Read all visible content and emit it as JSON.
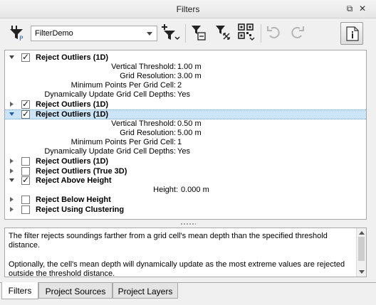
{
  "window": {
    "title": "Filters"
  },
  "toolbar": {
    "filter_set_value": "FilterDemo",
    "buttons": [
      "add-filter-icon",
      "remove-filter-icon",
      "collapse-all-icon",
      "qr-filter-icon",
      "undo-icon",
      "redo-icon",
      "info-icon"
    ]
  },
  "tree": {
    "f1": {
      "label": "Reject Outliers (1D)",
      "checked": true,
      "expanded": true,
      "params": [
        {
          "label": "Vertical Threshold:",
          "value": "1.00 m"
        },
        {
          "label": "Grid Resolution:",
          "value": "3.00 m"
        },
        {
          "label": "Minimum Points Per Grid Cell:",
          "value": "2"
        },
        {
          "label": "Dynamically Update Grid Cell Depths:",
          "value": "Yes"
        }
      ]
    },
    "f2": {
      "label": "Reject Outliers (1D)",
      "checked": true,
      "expanded": false
    },
    "f3": {
      "label": "Reject Outliers (1D)",
      "checked": true,
      "expanded": true,
      "selected": true,
      "params": [
        {
          "label": "Vertical Threshold:",
          "value": "0.50 m"
        },
        {
          "label": "Grid Resolution:",
          "value": "5.00 m"
        },
        {
          "label": "Minimum Points Per Grid Cell:",
          "value": "1"
        },
        {
          "label": "Dynamically Update Grid Cell Depths:",
          "value": "Yes"
        }
      ]
    },
    "f4": {
      "label": "Reject Outliers (1D)",
      "checked": false,
      "expanded": false
    },
    "f5": {
      "label": "Reject Outliers (True 3D)",
      "checked": false,
      "expanded": false
    },
    "f6": {
      "label": "Reject Above Height",
      "checked": true,
      "expanded": true,
      "params": [
        {
          "label": "Height:",
          "value": "0.000 m"
        }
      ]
    },
    "f7": {
      "label": "Reject Below Height",
      "checked": false,
      "expanded": false
    },
    "f8": {
      "label": "Reject Using Clustering",
      "checked": false,
      "expanded": false
    }
  },
  "description": {
    "p1": "The filter rejects soundings farther from a grid cell's mean depth than the specified threshold distance.",
    "p2": "Optionally, the cell's mean depth will dynamically update as the most extreme values are rejected outside the threshold distance."
  },
  "tabs": [
    "Filters",
    "Project Sources",
    "Project Layers"
  ],
  "colors": {
    "selection": "#cce4f7",
    "accent": "#1f5fa8"
  }
}
